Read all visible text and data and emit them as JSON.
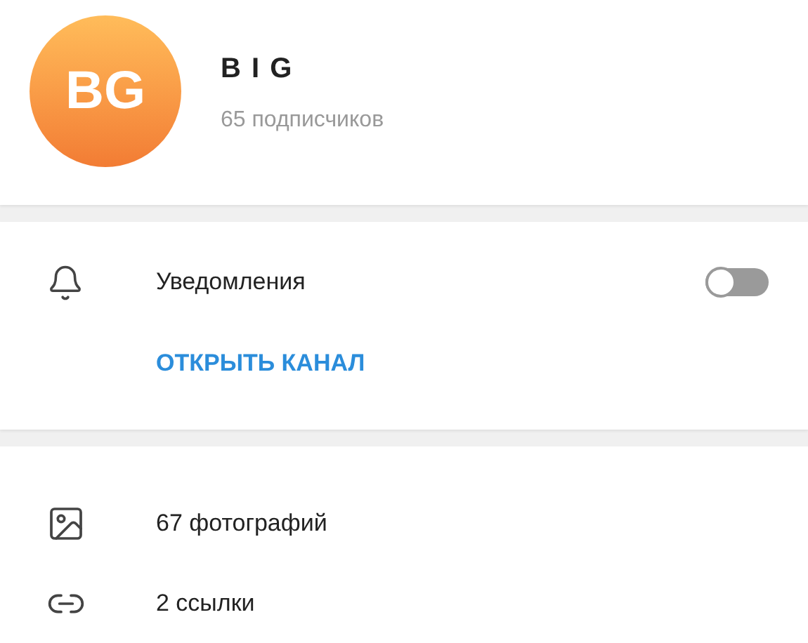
{
  "channel": {
    "avatar_initials": "BG",
    "title": "B I G",
    "subtitle": "65 подписчиков"
  },
  "settings": {
    "notifications": {
      "label": "Уведомления",
      "on": false
    },
    "open_channel": "ОТКРЫТЬ КАНАЛ"
  },
  "media": [
    {
      "kind": "photos",
      "label": "67 фотографий"
    },
    {
      "kind": "links",
      "label": "2 ссылки"
    }
  ]
}
